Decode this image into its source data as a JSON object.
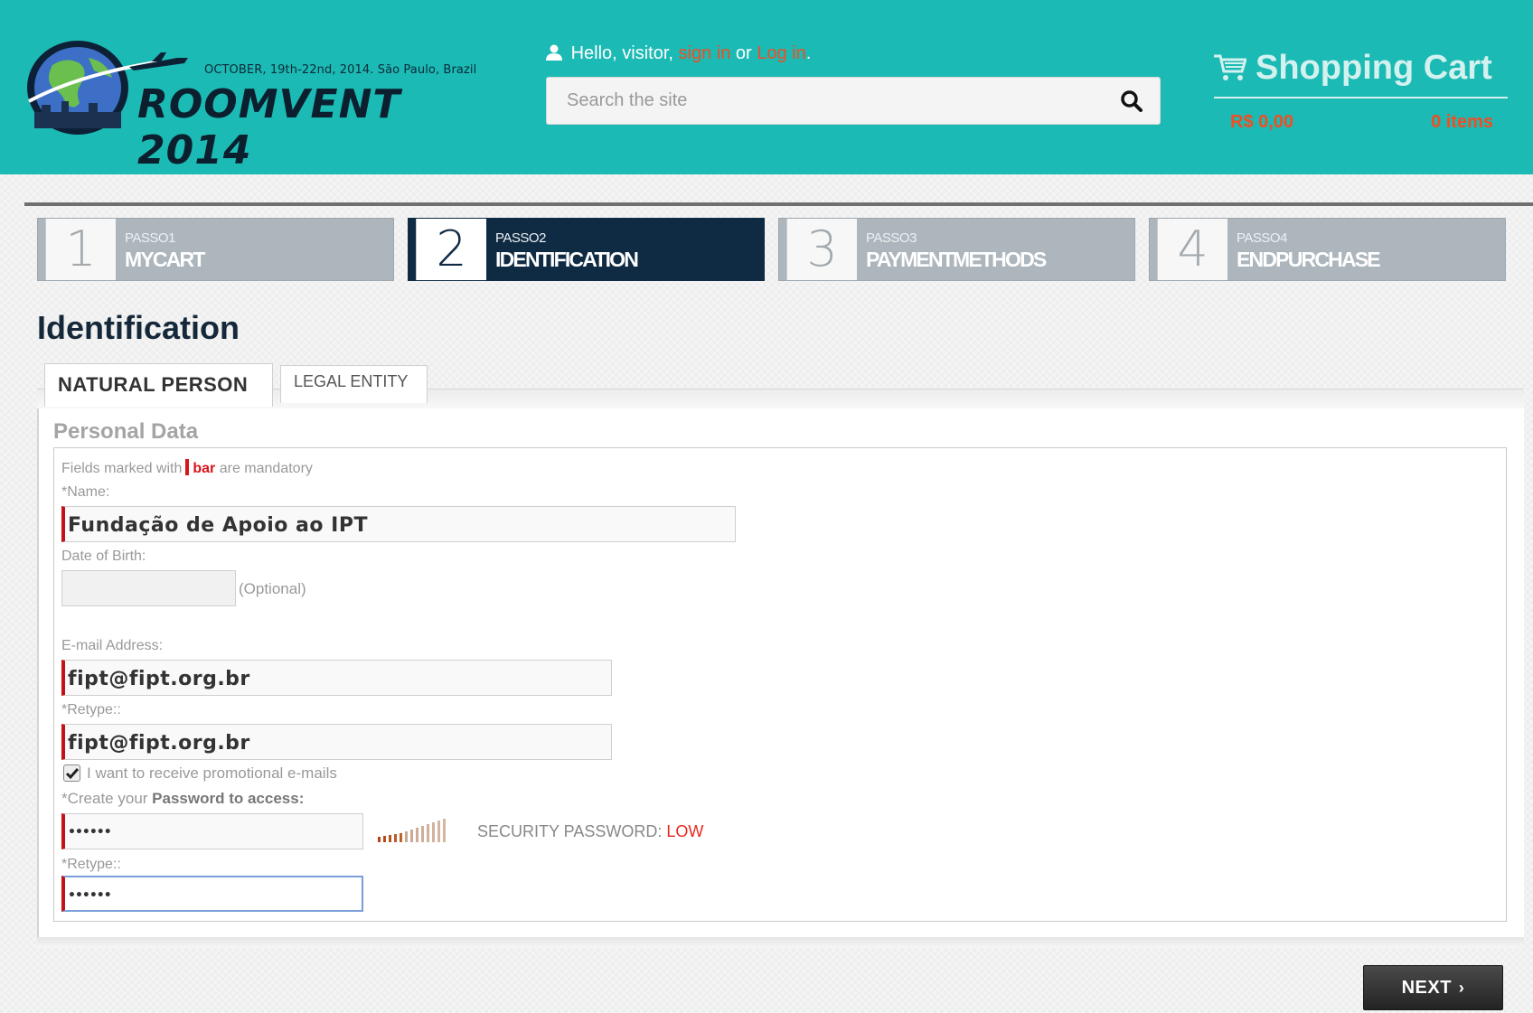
{
  "header": {
    "logo": {
      "date_line": "OCTOBER, 19th-22nd, 2014. São Paulo, Brazil",
      "title": "ROOMVENT 2014"
    },
    "greeting": {
      "prefix": "Hello, visitor,",
      "sign_in": "sign in",
      "or": "or",
      "log_in": "Log in",
      "suffix": "."
    },
    "search": {
      "placeholder": "Search the site"
    },
    "cart": {
      "title": "Shopping Cart",
      "total": "R$ 0,00",
      "items": "0 items"
    }
  },
  "steps": [
    {
      "number": "1",
      "passo": "PASSO1",
      "name": "MYCART"
    },
    {
      "number": "2",
      "passo": "PASSO2",
      "name": "IDENTIFICATION"
    },
    {
      "number": "3",
      "passo": "PASSO3",
      "name": "PAYMENTMETHODS"
    },
    {
      "number": "4",
      "passo": "PASSO4",
      "name": "ENDPURCHASE"
    }
  ],
  "page_title": "Identification",
  "tabs": {
    "natural": "NATURAL PERSON",
    "legal": "LEGAL ENTITY"
  },
  "form": {
    "section_title": "Personal Data",
    "note": {
      "prefix": "Fields marked with",
      "word": "bar",
      "suffix": "are mandatory"
    },
    "name_label": "*Name:",
    "name_value": "Fundação de Apoio ao IPT",
    "dob_label": "Date of Birth:",
    "dob_value": "",
    "dob_note": "(Optional)",
    "email_label": "E-mail Address:",
    "email_value": "fipt@fipt.org.br",
    "email_retype_label": "*Retype::",
    "email_retype_value": "fipt@fipt.org.br",
    "promo_label": "I want to receive promotional e-mails",
    "password_label_prefix": "*Create your",
    "password_label_bold": "Password to access:",
    "password_value": "••••••",
    "strength_label": "SECURITY PASSWORD:",
    "strength_value": "LOW",
    "password_retype_label": "*Retype::",
    "password_retype_value": "••••••"
  },
  "next_label": "NEXT",
  "colors": {
    "header": "#1cbab4",
    "accent_red": "#f04e23",
    "active_step": "#0f2b44",
    "mandatory": "#c4101a"
  }
}
